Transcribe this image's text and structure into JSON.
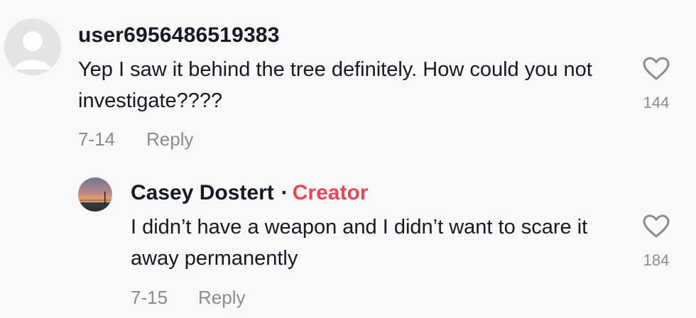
{
  "comment": {
    "username": "user6956486519383",
    "text": "Yep I saw it behind the tree definitely. How could you not investigate????",
    "date": "7-14",
    "reply_label": "Reply",
    "likes": "144"
  },
  "reply": {
    "username": "Casey Dostert",
    "separator": "·",
    "badge": "Creator",
    "text": "I didn’t have a weapon and I didn’t want to scare it away permanently",
    "date": "7-15",
    "reply_label": "Reply",
    "likes": "184"
  },
  "colors": {
    "background": "#f8f8f8",
    "text": "#161823",
    "muted": "#8a8b91",
    "creator_accent": "#e8465a"
  },
  "icons": {
    "like": "heart-outline-icon",
    "default_avatar": "user-placeholder-icon"
  }
}
